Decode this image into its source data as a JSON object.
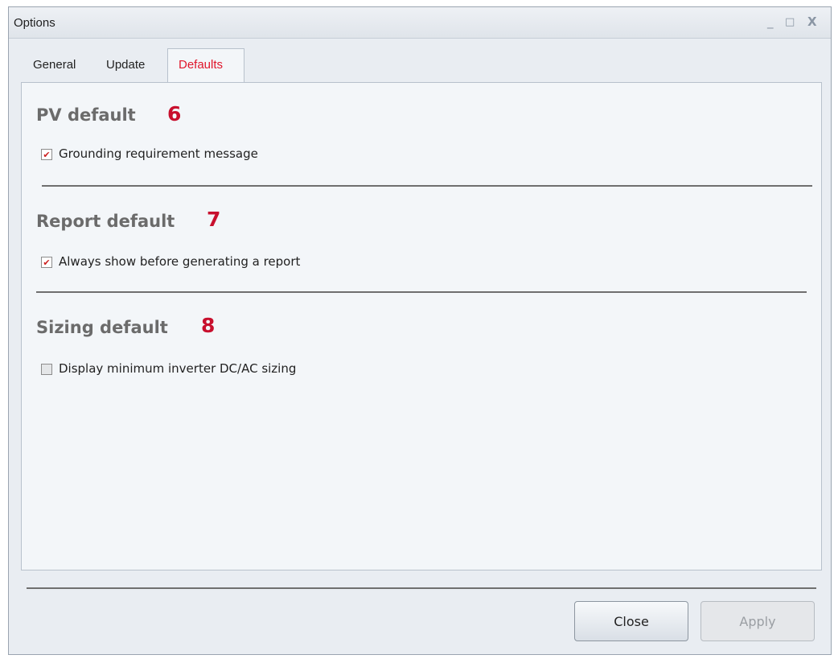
{
  "window": {
    "title": "Options",
    "controls": {
      "minimize": "_",
      "maximize": "□",
      "close": "X"
    }
  },
  "tabs": [
    {
      "label": "General",
      "active": false
    },
    {
      "label": "Update",
      "active": false
    },
    {
      "label": "Defaults",
      "active": true
    }
  ],
  "sections": [
    {
      "title": "PV default",
      "marker": "6",
      "checkbox": {
        "label": "Grounding requirement message",
        "checked": true
      }
    },
    {
      "title": "Report default",
      "marker": "7",
      "checkbox": {
        "label": "Always show before generating a report",
        "checked": true
      }
    },
    {
      "title": "Sizing default",
      "marker": "8",
      "checkbox": {
        "label": "Display minimum inverter DC/AC sizing",
        "checked": false
      }
    }
  ],
  "buttons": {
    "close": "Close",
    "apply": "Apply"
  },
  "colors": {
    "accent_tab": "#e0162b",
    "marker": "#c8102e",
    "check": "#cc1f1f"
  }
}
